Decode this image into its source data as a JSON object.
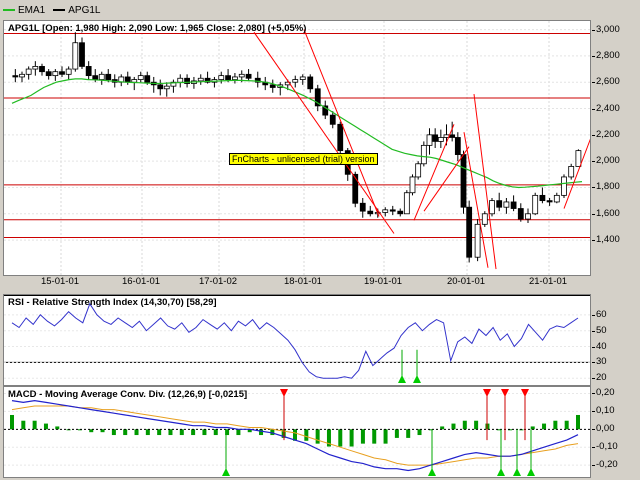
{
  "legend": [
    {
      "label": "EMA1",
      "color": "#22bb22"
    },
    {
      "label": "APG1L",
      "color": "#000000"
    }
  ],
  "price_pane": {
    "title": "APG1L [Open: 1,980  High: 2,090  Low: 1,965  Close: 2,080] (+5,05%)",
    "watermark": "FnCharts - unlicensed (trial) version",
    "ylim": [
      1150,
      3050
    ],
    "y_ticks": [
      "3,000",
      "2,800",
      "2,600",
      "2,400",
      "2,200",
      "2,000",
      "1,800",
      "1,600",
      "1,400"
    ],
    "y_tick_values": [
      3000,
      2800,
      2600,
      2400,
      2200,
      2000,
      1800,
      1600,
      1400
    ],
    "hlines": [
      2970,
      2480,
      1820,
      1555,
      1420
    ],
    "date_labels": [
      "15-01-01",
      "16-01-01",
      "17-01-02",
      "18-01-01",
      "19-01-01",
      "20-01-01",
      "21-01-01"
    ],
    "candles_by_day": [
      [
        [
          2650,
          2700,
          2600,
          2640
        ],
        [
          2640,
          2680,
          2600,
          2660
        ],
        [
          2660,
          2720,
          2620,
          2700
        ],
        [
          2700,
          2760,
          2650,
          2720
        ],
        [
          2720,
          2740,
          2650,
          2680
        ],
        [
          2680,
          2700,
          2620,
          2650
        ],
        [
          2650,
          2700,
          2610,
          2680
        ],
        [
          2680,
          2720,
          2640,
          2660
        ],
        [
          2660,
          2720,
          2620,
          2700
        ],
        [
          2700,
          2980,
          2680,
          2900
        ],
        [
          2900,
          2940,
          2700,
          2720
        ],
        [
          2720,
          2760,
          2620,
          2650
        ]
      ],
      [
        [
          2650,
          2700,
          2600,
          2620
        ],
        [
          2620,
          2680,
          2580,
          2660
        ],
        [
          2660,
          2700,
          2600,
          2620
        ],
        [
          2620,
          2660,
          2560,
          2600
        ],
        [
          2600,
          2660,
          2570,
          2640
        ],
        [
          2640,
          2680,
          2580,
          2600
        ],
        [
          2600,
          2640,
          2540,
          2620
        ],
        [
          2620,
          2680,
          2600,
          2650
        ],
        [
          2650,
          2680,
          2580,
          2600
        ],
        [
          2600,
          2640,
          2520,
          2580
        ],
        [
          2580,
          2620,
          2500,
          2550
        ],
        [
          2550,
          2600,
          2490,
          2570
        ]
      ],
      [
        [
          2570,
          2620,
          2520,
          2600
        ],
        [
          2600,
          2660,
          2560,
          2630
        ],
        [
          2630,
          2660,
          2560,
          2590
        ],
        [
          2590,
          2640,
          2550,
          2610
        ],
        [
          2610,
          2660,
          2580,
          2630
        ],
        [
          2630,
          2680,
          2590,
          2600
        ],
        [
          2600,
          2640,
          2560,
          2620
        ],
        [
          2620,
          2680,
          2590,
          2650
        ],
        [
          2650,
          2700,
          2600,
          2620
        ],
        [
          2620,
          2670,
          2590,
          2640
        ],
        [
          2640,
          2690,
          2600,
          2660
        ],
        [
          2660,
          2700,
          2610,
          2630
        ]
      ],
      [
        [
          2630,
          2680,
          2560,
          2600
        ],
        [
          2600,
          2640,
          2540,
          2580
        ],
        [
          2580,
          2620,
          2520,
          2560
        ],
        [
          2560,
          2600,
          2500,
          2580
        ],
        [
          2580,
          2620,
          2540,
          2600
        ],
        [
          2600,
          2650,
          2560,
          2620
        ],
        [
          2620,
          2660,
          2580,
          2640
        ],
        [
          2640,
          2660,
          2520,
          2550
        ],
        [
          2550,
          2580,
          2380,
          2420
        ],
        [
          2420,
          2460,
          2320,
          2350
        ],
        [
          2350,
          2380,
          2250,
          2280
        ],
        [
          2280,
          2300,
          2050,
          2080
        ],
        [
          2080,
          2100,
          1850,
          1900
        ],
        [
          1900,
          1920,
          1650,
          1680
        ],
        [
          1680,
          1720,
          1570,
          1620
        ],
        [
          1620,
          1660,
          1580,
          1600
        ],
        [
          1600,
          1640,
          1570,
          1610
        ],
        [
          1610,
          1650,
          1580,
          1630
        ],
        [
          1630,
          1660,
          1590,
          1620
        ],
        [
          1620,
          1640,
          1580,
          1600
        ]
      ],
      [
        [
          1600,
          1780,
          1600,
          1760
        ],
        [
          1760,
          1900,
          1740,
          1880
        ],
        [
          1880,
          2000,
          1860,
          1980
        ],
        [
          1980,
          2150,
          1960,
          2120
        ],
        [
          2120,
          2250,
          2050,
          2200
        ],
        [
          2200,
          2250,
          2100,
          2150
        ],
        [
          2150,
          2240,
          2100,
          2180
        ],
        [
          2180,
          2280,
          2120,
          2200
        ],
        [
          2200,
          2300,
          2150,
          2180
        ],
        [
          2180,
          2220,
          2000,
          2050
        ],
        [
          2050,
          2080,
          1600,
          1650
        ],
        [
          1650,
          1700,
          1230,
          1270
        ]
      ],
      [
        [
          1270,
          1560,
          1240,
          1520
        ],
        [
          1520,
          1620,
          1500,
          1600
        ],
        [
          1600,
          1720,
          1580,
          1700
        ],
        [
          1700,
          1760,
          1620,
          1650
        ],
        [
          1650,
          1720,
          1600,
          1690
        ],
        [
          1690,
          1740,
          1620,
          1640
        ],
        [
          1640,
          1680,
          1540,
          1560
        ],
        [
          1560,
          1640,
          1530,
          1600
        ],
        [
          1600,
          1760,
          1590,
          1740
        ],
        [
          1740,
          1800,
          1680,
          1700
        ],
        [
          1700,
          1720,
          1660,
          1690
        ],
        [
          1690,
          1760,
          1680,
          1740
        ],
        [
          1740,
          1900,
          1720,
          1880
        ],
        [
          1880,
          1980,
          1860,
          1960
        ],
        [
          1960,
          2090,
          1965,
          2080
        ]
      ]
    ],
    "ema": [
      2440,
      2460,
      2480,
      2500,
      2530,
      2560,
      2580,
      2600,
      2610,
      2620,
      2625,
      2625,
      2620,
      2618,
      2615,
      2612,
      2608,
      2604,
      2600,
      2598,
      2596,
      2594,
      2592,
      2590,
      2592,
      2594,
      2596,
      2598,
      2600,
      2602,
      2604,
      2606,
      2608,
      2610,
      2612,
      2614,
      2614,
      2612,
      2610,
      2606,
      2600,
      2590,
      2575,
      2560,
      2540,
      2520,
      2500,
      2475,
      2450,
      2420,
      2390,
      2360,
      2330,
      2300,
      2270,
      2240,
      2210,
      2180,
      2150,
      2120,
      2090,
      2075,
      2060,
      2050,
      2040,
      2035,
      2030,
      2020,
      2005,
      1990,
      1975,
      1955,
      1935,
      1915,
      1895,
      1875,
      1850,
      1830,
      1815,
      1805,
      1800,
      1802,
      1806,
      1810,
      1815,
      1820,
      1825,
      1830,
      1835,
      1840,
      1845
    ]
  },
  "rsi_pane": {
    "title": "RSI - Relative Strength Index (14,30,70) [58,29]",
    "ylim": [
      17,
      70
    ],
    "y_ticks": [
      "60",
      "50",
      "40",
      "30",
      "20"
    ],
    "y_tick_values": [
      60,
      50,
      40,
      30,
      20
    ],
    "hline": 30,
    "values": [
      55,
      52,
      58,
      54,
      60,
      56,
      53,
      57,
      62,
      58,
      55,
      67,
      60,
      56,
      54,
      58,
      55,
      52,
      56,
      50,
      54,
      58,
      53,
      51,
      55,
      49,
      52,
      57,
      54,
      51,
      55,
      50,
      56,
      53,
      57,
      51,
      55,
      52,
      48,
      44,
      38,
      30,
      24,
      21,
      20,
      20,
      20,
      21,
      20,
      25,
      37,
      28,
      32,
      36,
      39,
      47,
      52,
      55,
      50,
      54,
      57,
      55,
      31,
      43,
      46,
      42,
      51,
      47,
      52,
      44,
      48,
      40,
      45,
      54,
      49,
      44,
      51,
      53,
      52,
      55,
      58
    ]
  },
  "macd_pane": {
    "title": "MACD - Moving Average Conv. Div. (12,26,9) [-0,0215]",
    "ylim": [
      -0.255,
      0.225
    ],
    "y_ticks": [
      "0,20",
      "0,10",
      "0,00",
      "-0,10",
      "-0,20"
    ],
    "y_tick_values": [
      0.2,
      0.1,
      0.0,
      -0.1,
      -0.2
    ],
    "macd": [
      0.16,
      0.15,
      0.16,
      0.15,
      0.14,
      0.13,
      0.12,
      0.11,
      0.1,
      0.09,
      0.08,
      0.07,
      0.06,
      0.05,
      0.04,
      0.03,
      0.02,
      0.02,
      0.01,
      0.01,
      0.0,
      0.0,
      -0.01,
      -0.02,
      -0.04,
      -0.06,
      -0.08,
      -0.11,
      -0.14,
      -0.16,
      -0.18,
      -0.19,
      -0.21,
      -0.22,
      -0.22,
      -0.23,
      -0.22,
      -0.2,
      -0.18,
      -0.16,
      -0.14,
      -0.13,
      -0.14,
      -0.15,
      -0.15,
      -0.14,
      -0.12,
      -0.1,
      -0.08,
      -0.06,
      -0.03
    ],
    "signal": [
      0.11,
      0.12,
      0.13,
      0.13,
      0.13,
      0.13,
      0.12,
      0.12,
      0.11,
      0.11,
      0.1,
      0.09,
      0.08,
      0.07,
      0.06,
      0.05,
      0.04,
      0.04,
      0.03,
      0.03,
      0.02,
      0.01,
      0.01,
      0.0,
      -0.01,
      -0.02,
      -0.04,
      -0.06,
      -0.08,
      -0.1,
      -0.12,
      -0.14,
      -0.16,
      -0.17,
      -0.19,
      -0.2,
      -0.2,
      -0.2,
      -0.19,
      -0.18,
      -0.17,
      -0.16,
      -0.16,
      -0.15,
      -0.15,
      -0.14,
      -0.13,
      -0.12,
      -0.11,
      -0.09,
      -0.08
    ]
  }
}
